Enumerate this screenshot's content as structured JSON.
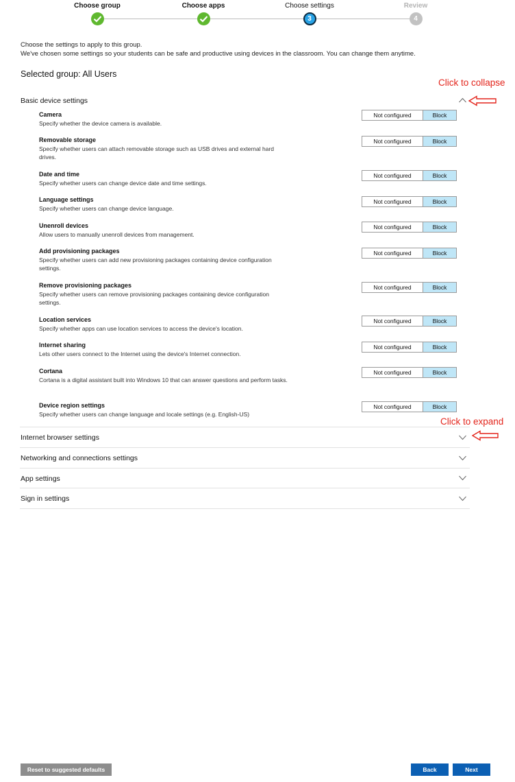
{
  "stepper": {
    "steps": [
      {
        "label": "Choose group",
        "state": "done",
        "marker": ""
      },
      {
        "label": "Choose apps",
        "state": "done",
        "marker": ""
      },
      {
        "label": "Choose settings",
        "state": "current",
        "marker": "3"
      },
      {
        "label": "Review",
        "state": "upcoming",
        "marker": "4"
      }
    ]
  },
  "intro": {
    "line1": "Choose the settings to apply to this group.",
    "line2": "We've chosen some settings so your students can be safe and productive using devices in the classroom. You can change them anytime."
  },
  "selected_group": "Selected group: All Users",
  "annotations": {
    "collapse": "Click to collapse",
    "expand": "Click to expand"
  },
  "sections": {
    "basic": {
      "title": "Basic device settings",
      "expanded": true,
      "settings": [
        {
          "title": "Camera",
          "desc": "Specify whether the device camera is available.",
          "not_configured": "Not configured",
          "block": "Block",
          "selected": "Block"
        },
        {
          "title": "Removable storage",
          "desc": "Specify whether users can attach removable storage such as USB drives and external hard drives.",
          "not_configured": "Not configured",
          "block": "Block",
          "selected": "Block"
        },
        {
          "title": "Date and time",
          "desc": "Specify whether users can change device date and time settings.",
          "not_configured": "Not configured",
          "block": "Block",
          "selected": "Block"
        },
        {
          "title": "Language settings",
          "desc": "Specify whether users can change device language.",
          "not_configured": "Not configured",
          "block": "Block",
          "selected": "Block"
        },
        {
          "title": "Unenroll devices",
          "desc": "Allow users to manually unenroll devices from management.",
          "not_configured": "Not configured",
          "block": "Block",
          "selected": "Block"
        },
        {
          "title": "Add provisioning packages",
          "desc": "Specify whether users can add new provisioning packages containing device configuration settings.",
          "not_configured": "Not configured",
          "block": "Block",
          "selected": "Block"
        },
        {
          "title": "Remove provisioning packages",
          "desc": "Specify whether users can remove provisioning packages containing device configuration settings.",
          "not_configured": "Not configured",
          "block": "Block",
          "selected": "Block"
        },
        {
          "title": "Location services",
          "desc": "Specify whether apps can use location services to access the device's location.",
          "not_configured": "Not configured",
          "block": "Block",
          "selected": "Block"
        },
        {
          "title": "Internet sharing",
          "desc": "Lets other users connect to the Internet using the device's Internet connection.",
          "not_configured": "Not configured",
          "block": "Block",
          "selected": "Block"
        },
        {
          "title": "Cortana",
          "desc": "Cortana is a digital assistant built into Windows 10 that can answer questions and perform tasks.",
          "not_configured": "Not configured",
          "block": "Block",
          "selected": "Block"
        },
        {
          "title": "Device region settings",
          "desc": "Specify whether users can change language and locale settings (e.g. English-US)",
          "not_configured": "Not configured",
          "block": "Block",
          "selected": "Block"
        }
      ]
    },
    "collapsed": [
      {
        "title": "Internet browser settings",
        "expanded": false
      },
      {
        "title": "Networking and connections settings",
        "expanded": false
      },
      {
        "title": "App settings",
        "expanded": false
      },
      {
        "title": "Sign in settings",
        "expanded": false
      }
    ]
  },
  "footer": {
    "reset": "Reset to suggested defaults",
    "back": "Back",
    "next": "Next"
  },
  "colors": {
    "done": "#5fb82f",
    "current": "#29a3e6",
    "upcoming": "#c2c2c2",
    "block_selected": "#bfe6f7",
    "primary_button": "#0b5fb3",
    "annotation": "#e3241b"
  }
}
